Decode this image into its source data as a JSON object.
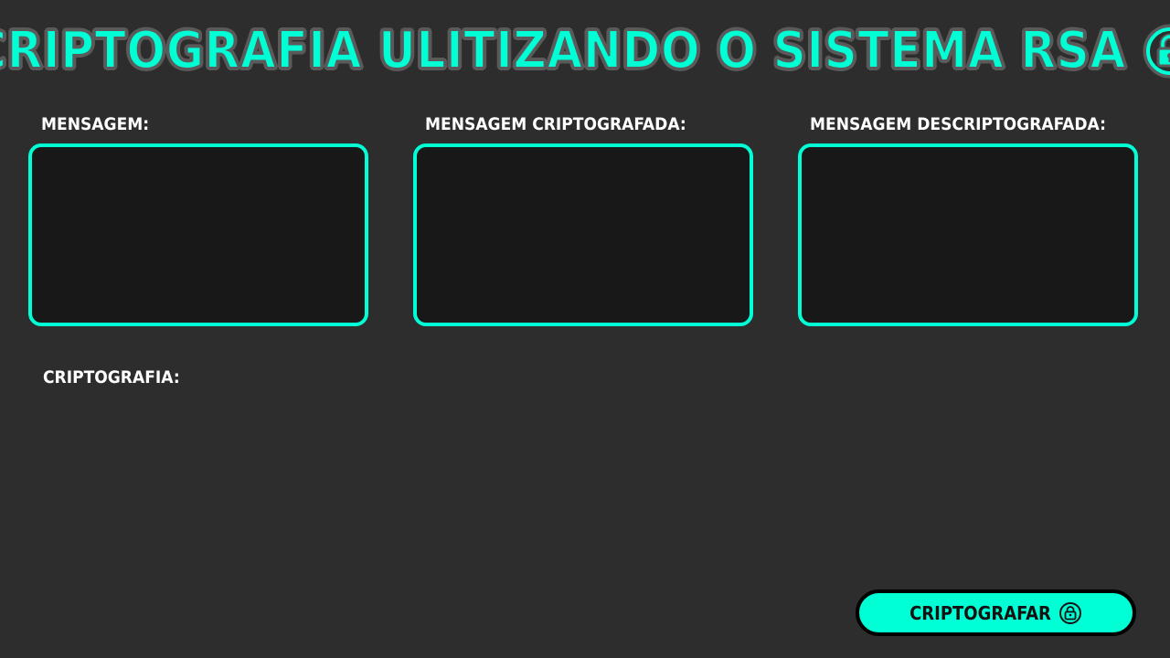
{
  "header": {
    "title": "CRIPTOGRAFIA ULITIZANDO O SISTEMA RSA",
    "icon": "lock-icon"
  },
  "fields": [
    {
      "label": "MENSAGEM:",
      "value": ""
    },
    {
      "label": "MENSAGEM CRIPTOGRAFADA:",
      "value": ""
    },
    {
      "label": "MENSAGEM DESCRIPTOGRAFADA:",
      "value": ""
    }
  ],
  "section": {
    "label": "CRIPTOGRAFIA:"
  },
  "actions": {
    "encrypt_label": "CRIPTOGRAFAR",
    "encrypt_icon": "lock-icon"
  },
  "colors": {
    "background": "#2d2d2d",
    "accent": "#00ffd5",
    "box_fill": "#181818",
    "title_outline": "#5a5a5a",
    "label_text": "#ffffff",
    "button_border": "#000000"
  }
}
